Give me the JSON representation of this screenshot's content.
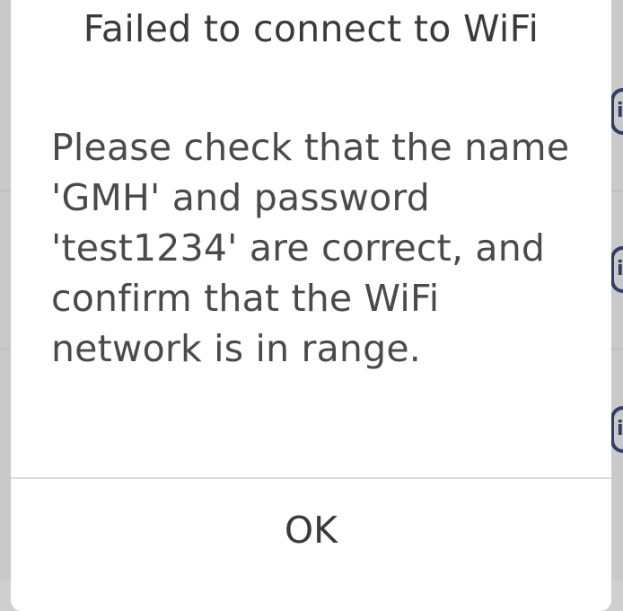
{
  "dialog": {
    "title": "Failed to connect to WiFi",
    "message": "Please check that the name 'GMH' and password 'test1234' are correct, and confirm that the WiFi network is in range.",
    "ok_label": "OK"
  },
  "background": {
    "info_icon_glyph": "i"
  }
}
